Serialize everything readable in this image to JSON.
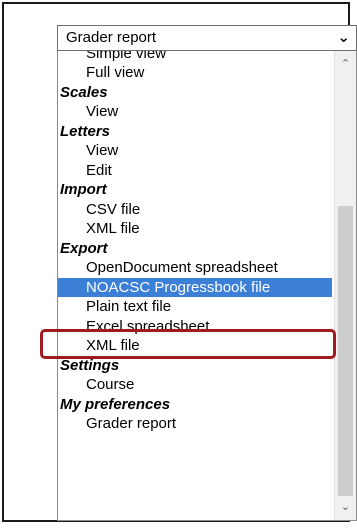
{
  "select": {
    "value": "Grader report",
    "arrow": "⌄"
  },
  "list": {
    "items": [
      {
        "kind": "option",
        "label": "Simple view"
      },
      {
        "kind": "option",
        "label": "Full view"
      },
      {
        "kind": "group",
        "label": "Scales"
      },
      {
        "kind": "option",
        "label": "View"
      },
      {
        "kind": "group",
        "label": "Letters"
      },
      {
        "kind": "option",
        "label": "View"
      },
      {
        "kind": "option",
        "label": "Edit"
      },
      {
        "kind": "group",
        "label": "Import"
      },
      {
        "kind": "option",
        "label": "CSV file"
      },
      {
        "kind": "option",
        "label": "XML file"
      },
      {
        "kind": "group",
        "label": "Export"
      },
      {
        "kind": "option",
        "label": "OpenDocument spreadsheet"
      },
      {
        "kind": "option",
        "label": "NOACSC Progressbook file",
        "selected": true
      },
      {
        "kind": "option",
        "label": "Plain text file"
      },
      {
        "kind": "option",
        "label": "Excel spreadsheet"
      },
      {
        "kind": "option",
        "label": "XML file"
      },
      {
        "kind": "group",
        "label": "Settings"
      },
      {
        "kind": "option",
        "label": "Course"
      },
      {
        "kind": "group",
        "label": "My preferences"
      },
      {
        "kind": "option",
        "label": "Grader report"
      }
    ]
  },
  "scrollbar": {
    "up_icon": "⌃",
    "down_icon": "⌄"
  },
  "colors": {
    "selected_bg": "#3c7fd6",
    "highlight_border": "#a01b1f"
  }
}
